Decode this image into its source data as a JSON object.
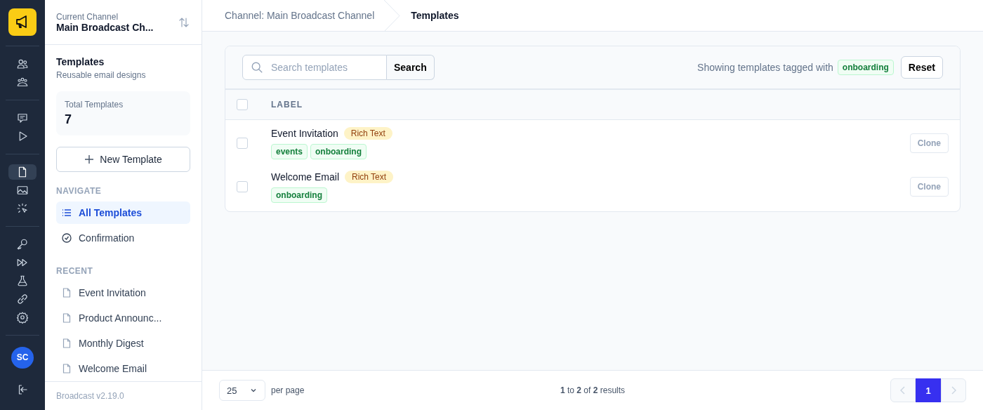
{
  "rail": {
    "groups": [
      [
        {
          "kind": "users",
          "selected": false
        },
        {
          "kind": "group",
          "selected": false
        }
      ],
      [
        {
          "kind": "chat",
          "selected": false
        },
        {
          "kind": "play",
          "selected": false
        }
      ],
      [
        {
          "kind": "document",
          "selected": true
        },
        {
          "kind": "image",
          "selected": false
        },
        {
          "kind": "click",
          "selected": false
        }
      ],
      [
        {
          "kind": "key",
          "selected": false
        },
        {
          "kind": "forward",
          "selected": false
        },
        {
          "kind": "flask",
          "selected": false
        },
        {
          "kind": "link",
          "selected": false
        },
        {
          "kind": "gear",
          "selected": false
        }
      ]
    ],
    "avatar": "SC"
  },
  "channel": {
    "label": "Current Channel",
    "name": "Main Broadcast Ch..."
  },
  "section": {
    "title": "Templates",
    "subtitle": "Reusable email designs"
  },
  "stat": {
    "label": "Total Templates",
    "value": "7"
  },
  "new_button": "New Template",
  "navigate": {
    "heading": "NAVIGATE",
    "items": [
      {
        "label": "All Templates",
        "kind": "list",
        "selected": true
      },
      {
        "label": "Confirmation",
        "kind": "check",
        "selected": false
      }
    ]
  },
  "recent": {
    "heading": "RECENT",
    "items": [
      "Event Invitation",
      "Product Announc...",
      "Monthly Digest",
      "Welcome Email"
    ]
  },
  "version": "Broadcast v2.19.0",
  "breadcrumbs": [
    {
      "label": "Channel: Main Broadcast Channel",
      "selected": false
    },
    {
      "label": "Templates",
      "selected": true
    }
  ],
  "search": {
    "placeholder": "Search templates",
    "button": "Search"
  },
  "filter": {
    "text": "Showing templates tagged with",
    "tag": "onboarding",
    "reset": "Reset"
  },
  "table": {
    "select_all_checked": false,
    "columns": [
      "LABEL"
    ],
    "rows": [
      {
        "name": "Event Invitation",
        "type": "Rich Text",
        "tags": [
          "events",
          "onboarding"
        ],
        "checked": false,
        "action": "Clone",
        "disabled": true
      },
      {
        "name": "Welcome Email",
        "type": "Rich Text",
        "tags": [
          "onboarding"
        ],
        "checked": false,
        "action": "Clone",
        "disabled": true
      }
    ]
  },
  "footer": {
    "per_page": "25",
    "per_page_label": "per page",
    "results": "**1** to **2** of **2** results",
    "pages": [
      {
        "label": "1",
        "selected": true
      }
    ]
  }
}
